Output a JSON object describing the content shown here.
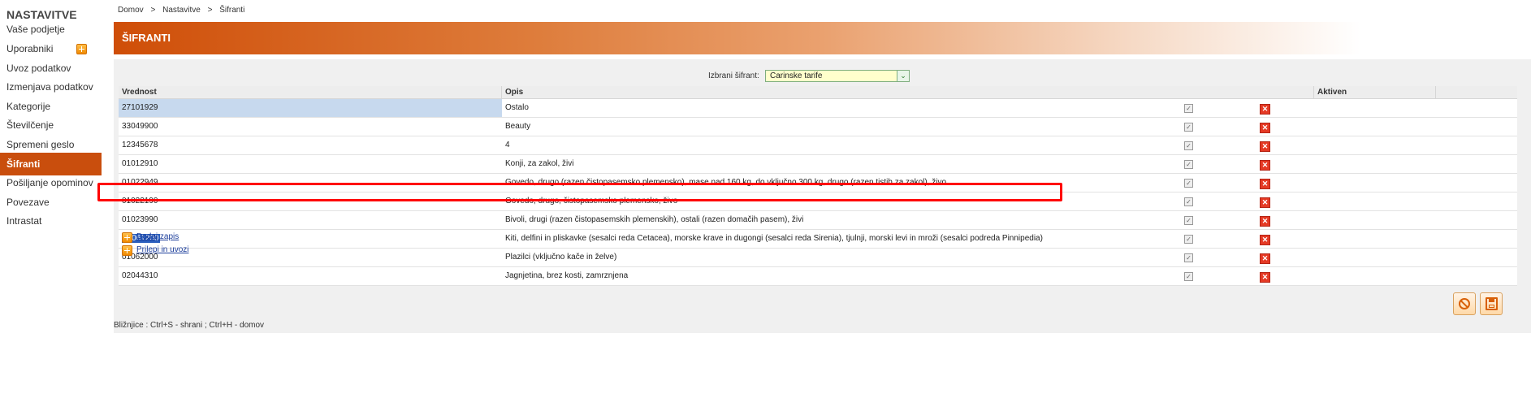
{
  "sidebar": {
    "title": "NASTAVITVE",
    "items": [
      {
        "label": "Vaše podjetje"
      },
      {
        "label": "Uporabniki"
      },
      {
        "label": "Uvoz podatkov"
      },
      {
        "label": "Izmenjava podatkov"
      },
      {
        "label": "Kategorije"
      },
      {
        "label": "Številčenje"
      },
      {
        "label": "Spremeni geslo"
      },
      {
        "label": "Šifranti"
      },
      {
        "label": "Pošiljanje opominov"
      },
      {
        "label": "Povezave"
      },
      {
        "label": "Intrastat"
      }
    ],
    "active_index": 7,
    "accent_color": "#c94e0d"
  },
  "breadcrumb": [
    "Domov",
    ">",
    "Nastavitve",
    ">",
    "Šifranti"
  ],
  "header": {
    "title": "ŠIFRANTI"
  },
  "selector": {
    "label": "Izbrani šifrant:",
    "value": "Carinske tarife"
  },
  "table": {
    "columns": [
      "Vrednost",
      "Opis",
      "Aktiven"
    ],
    "rows": [
      {
        "value": "27101929",
        "desc": "Ostalo",
        "active": true
      },
      {
        "value": "33049900",
        "desc": "Beauty",
        "active": true
      },
      {
        "value": "12345678",
        "desc": "4",
        "active": true
      },
      {
        "value": "01012910",
        "desc": "Konji, za zakol, živi",
        "active": true
      },
      {
        "value": "01022949",
        "desc": "Govedo, drugo (razen čistopasemsko plemensko), mase nad 160 kg, do vključno 300 kg, drugo (razen tistih za zakol), živo",
        "active": true
      },
      {
        "value": "01022190",
        "desc": "Govedo, drugo, čistopasemsko plemensko, živo",
        "active": true
      },
      {
        "value": "01023990",
        "desc": "Bivoli, drugi (razen čistopasemskih plemenskih), ostali (razen domačih pasem), živi",
        "active": true
      },
      {
        "value": "01061200",
        "desc": "Kiti, delfini in pliskavke (sesalci reda Cetacea), morske krave in dugongi (sesalci reda Sirenia), tjulnji, morski levi in mroži (sesalci podreda Pinnipedia)",
        "active": true
      },
      {
        "value": "01062000",
        "desc": "Plazilci (vključno kače in želve)",
        "active": true
      },
      {
        "value": "02044310",
        "desc": "Jagnjetina, brez kosti, zamrznjena",
        "active": true
      }
    ],
    "highlighted_row_index": 7
  },
  "actions": {
    "add_record": "Dodaj zapis",
    "paste_import": "Prilepi in uvozi"
  },
  "footer": {
    "shortcuts": "Bližnjice : Ctrl+S - shrani ;  Ctrl+H - domov"
  },
  "icons": {
    "add": "plus-icon",
    "delete": "delete-icon",
    "checkbox": "checkbox-icon",
    "cancel": "cancel-icon",
    "save": "save-icon",
    "dropdown": "chevron-down-icon"
  }
}
